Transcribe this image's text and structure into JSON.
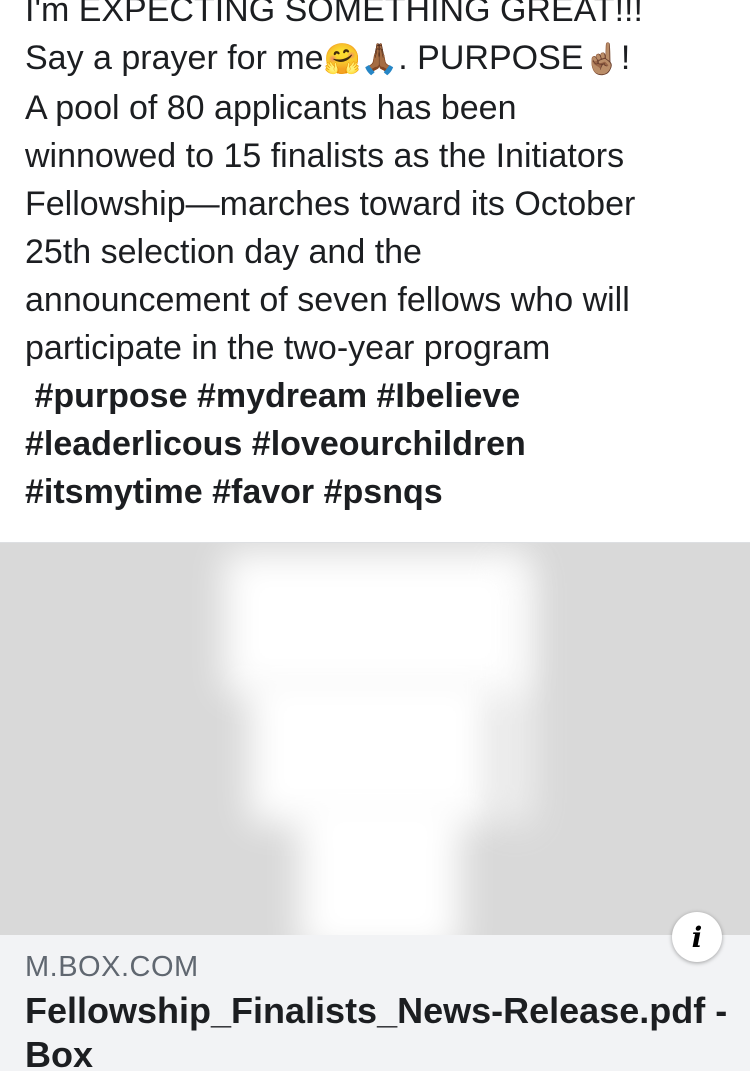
{
  "post": {
    "lines": [
      "I'm EXPECTING SOMETHING GREAT!!!",
      "A pool of 80 applicants has been",
      "winnowed to 15 finalists as the Initiators",
      "Fellowship—marches toward its October",
      "25th selection day and the",
      "announcement of seven fellows who will",
      "participate in the two-year program"
    ],
    "prayer_line": {
      "text_before": "Say a prayer for me",
      "emoji_1": "🤗",
      "emoji_2": "🙏🏾",
      "text_middle": ". PURPOSE",
      "emoji_3": "☝🏽",
      "text_after": "!"
    },
    "hashtags": [
      "#purpose",
      "#mydream",
      "#Ibelieve",
      "#leaderlicous",
      "#loveourchildren",
      "#itsmytime",
      "#favor",
      "#psnqs"
    ]
  },
  "link_preview": {
    "domain": "M.BOX.COM",
    "title": "Fellowship_Finalists_News-Release.pdf - Box",
    "info_icon": "info-icon",
    "info_glyph": "i",
    "image_background": "#d9d9d9"
  }
}
